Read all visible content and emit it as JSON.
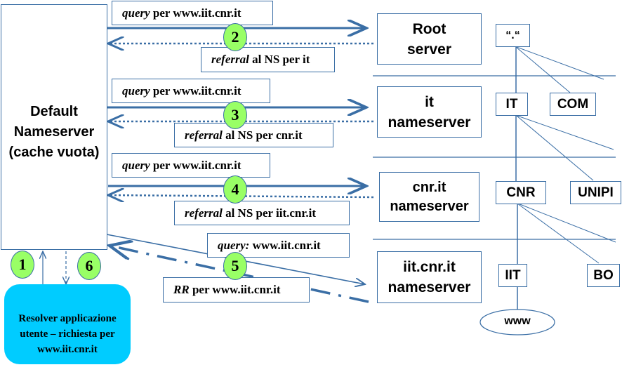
{
  "default_ns": {
    "line1": "Default",
    "line2": "Nameserver",
    "line3": "(cache vuota)"
  },
  "resolver": {
    "line1": "Resolver applicazione",
    "line2": "utente – richiesta per",
    "line3": "www.iit.cnr.it"
  },
  "steps": [
    "1",
    "2",
    "3",
    "4",
    "5",
    "6"
  ],
  "messages": [
    {
      "em": "query",
      "rest": " per www.iit.cnr.it"
    },
    {
      "em": "referral",
      "rest": " al NS per it"
    },
    {
      "em": "query",
      "rest": " per www.iit.cnr.it"
    },
    {
      "em": "referral",
      "rest": " al NS per cnr.it"
    },
    {
      "em": "query",
      "rest": " per www.iit.cnr.it"
    },
    {
      "em": "referral",
      "rest": " al NS per iit.cnr.it"
    },
    {
      "em": "query:",
      "rest": " www.iit.cnr.it"
    },
    {
      "em": "RR",
      "rest": " per www.iit.cnr.it"
    }
  ],
  "servers": [
    {
      "line1": "Root",
      "line2": "server"
    },
    {
      "line1": "it",
      "line2": "nameserver"
    },
    {
      "line1": "cnr.it",
      "line2": "nameserver"
    },
    {
      "line1": "iit.cnr.it",
      "line2": "nameserver"
    }
  ],
  "tree": {
    "root": "“.“",
    "it": "IT",
    "com": "COM",
    "cnr": "CNR",
    "unipi": "UNIPI",
    "iit": "IIT",
    "bo": "BO",
    "www": "www"
  },
  "colors": {
    "line": "#3a6ea5",
    "resolver_fill": "#00ccff",
    "step_fill": "#99ff66"
  }
}
